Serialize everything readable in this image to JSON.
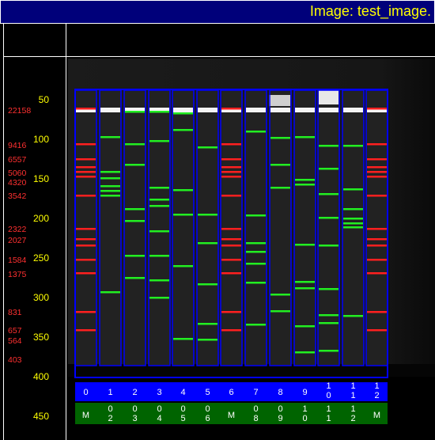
{
  "title": "Image:  test_image.",
  "axis": {
    "y_ticks": [
      "50",
      "100",
      "150",
      "200",
      "250",
      "300",
      "350",
      "400",
      "450"
    ],
    "marker_sizes": [
      "22158",
      "9416",
      "6557",
      "5060",
      "4320",
      "3542",
      "2322",
      "2027",
      "1584",
      "1375",
      "831",
      "657",
      "564",
      "403"
    ]
  },
  "lanes": {
    "numbers": [
      "0",
      "1",
      "2",
      "3",
      "4",
      "5",
      "6",
      "7",
      "8",
      "9",
      "10",
      "11",
      "12"
    ],
    "numbers_display": [
      [
        "0"
      ],
      [
        "1"
      ],
      [
        "2"
      ],
      [
        "3"
      ],
      [
        "4"
      ],
      [
        "5"
      ],
      [
        "6"
      ],
      [
        "7"
      ],
      [
        "8"
      ],
      [
        "9"
      ],
      [
        "1",
        "0"
      ],
      [
        "1",
        "1"
      ],
      [
        "1",
        "2"
      ]
    ],
    "names_display": [
      [
        "M"
      ],
      [
        "0",
        "2"
      ],
      [
        "0",
        "3"
      ],
      [
        "0",
        "4"
      ],
      [
        "0",
        "5"
      ],
      [
        "0",
        "6"
      ],
      [
        "M"
      ],
      [
        "0",
        "8"
      ],
      [
        "0",
        "9"
      ],
      [
        "1",
        "0"
      ],
      [
        "1",
        "1"
      ],
      [
        "1",
        "2"
      ],
      [
        "M"
      ]
    ]
  },
  "colors": {
    "background": "#000000",
    "title_bar": "#00007a",
    "title_text": "#ffff00",
    "tick_text": "#ffff00",
    "marker_text": "#ff3030",
    "lane_box": "#0000ff",
    "lane_number_bar": "#0000ff",
    "lane_name_bar": "#006400",
    "marker_band": "#ff2020",
    "sample_band": "#22ee22"
  },
  "bands": {
    "marker_positions": [
      22158,
      9416,
      6557,
      5060,
      4320,
      3542,
      2322,
      2027,
      1584,
      1375,
      831,
      657,
      564,
      403
    ]
  }
}
